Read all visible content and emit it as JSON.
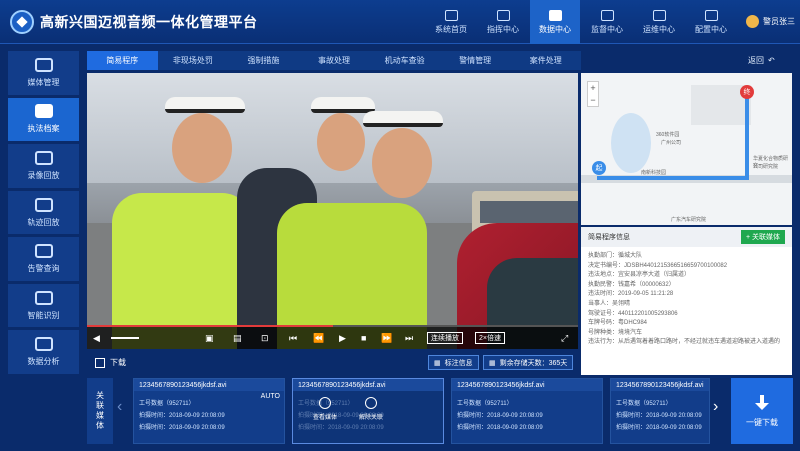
{
  "header": {
    "title": "高新兴国迈视音频一体化管理平台",
    "nav": [
      {
        "label": "系统首页",
        "icon": "home-icon",
        "active": false
      },
      {
        "label": "指挥中心",
        "icon": "command-icon",
        "active": false
      },
      {
        "label": "数据中心",
        "icon": "data-icon",
        "active": true
      },
      {
        "label": "监督中心",
        "icon": "monitor-icon",
        "active": false
      },
      {
        "label": "运维中心",
        "icon": "maintenance-icon",
        "active": false
      },
      {
        "label": "配置中心",
        "icon": "config-icon",
        "active": false
      }
    ],
    "user": "警员张三"
  },
  "sidebar": {
    "items": [
      {
        "label": "媒体管理",
        "icon": "media-icon",
        "active": false
      },
      {
        "label": "执法档案",
        "icon": "archive-icon",
        "active": true
      },
      {
        "label": "录像回放",
        "icon": "playback-icon",
        "active": false
      },
      {
        "label": "轨迹回放",
        "icon": "track-icon",
        "active": false
      },
      {
        "label": "告警查询",
        "icon": "alarm-icon",
        "active": false
      },
      {
        "label": "智能识别",
        "icon": "recognition-icon",
        "active": false
      },
      {
        "label": "数据分析",
        "icon": "analysis-icon",
        "active": false
      }
    ]
  },
  "tabs": [
    {
      "label": "简易程序",
      "active": true
    },
    {
      "label": "非现场处罚",
      "active": false
    },
    {
      "label": "强制措施",
      "active": false
    },
    {
      "label": "事故处理",
      "active": false
    },
    {
      "label": "机动车查验",
      "active": false
    },
    {
      "label": "警情管理",
      "active": false
    },
    {
      "label": "案件处理",
      "active": false
    }
  ],
  "back_label": "返回",
  "player": {
    "progress": 0.5,
    "volume": 0.7,
    "continuous_label": "连续播放",
    "speed_label": "2×倍速"
  },
  "download_label": "下载",
  "mark_label": "标注信息",
  "days_label": "剩余存储天数：365天",
  "map": {
    "start_label": "起",
    "end_label": "终",
    "poi_1": "360软件园",
    "poi_2": "广州公司",
    "poi_3": "华夏化合物质研究",
    "poi_4": "公司研究院",
    "poi_5": "南新科技园",
    "poi_6": "广东汽车研究院"
  },
  "info": {
    "title": "简易程序信息",
    "assoc_button": "关联媒体",
    "rows": [
      "执勤部门：循城大队",
      "决定书编号：JDSBH4401215366516659700100082",
      "违法地点：宜安县凉亭大道（归属道）",
      "执勤民警：钱嘉希（00000632）",
      "违法时间：2019-09-05 11:21:28",
      "当事人：吴翎晴",
      "驾驶证号：440112201005293806",
      "车牌号码：粤DHC984",
      "号牌种类：境境汽车",
      "违法行为：从后遇驾着着路口路时，不经过就违车遇道迎路被进入道遇的"
    ]
  },
  "strip": {
    "label": "关联媒体",
    "clips": [
      {
        "name": "1234567890123456jkdsf.avi",
        "badge": "AUTO",
        "device": "工号数据（952711）",
        "capture": "拍摄时间：2018-09-09 20:08:09",
        "upload": "拍摄时间：2018-09-09 20:08:09",
        "active": false
      },
      {
        "name": "1234567890123456jkdsf.avi",
        "badge": "",
        "device": "工号数据（952711）",
        "capture": "拍摄时间：2018-09-09 20:08:09",
        "upload": "拍摄时间：2018-09-09 20:08:09",
        "active": true
      },
      {
        "name": "1234567890123456jkdsf.avi",
        "badge": "",
        "device": "工号数据（952711）",
        "capture": "拍摄时间：2018-09-09 20:08:09",
        "upload": "拍摄时间：2018-09-09 20:08:09",
        "active": false
      },
      {
        "name": "1234567890123456jkdsf.avi",
        "badge": "",
        "device": "工号数据（952711）",
        "capture": "拍摄时间：2018-09-09 20:08:09",
        "upload": "拍摄时间：2018-09-09 20:08:09",
        "active": false
      }
    ],
    "view_media_label": "查看媒体",
    "unlink_label": "解除关联",
    "one_click_download": "一键下载"
  }
}
